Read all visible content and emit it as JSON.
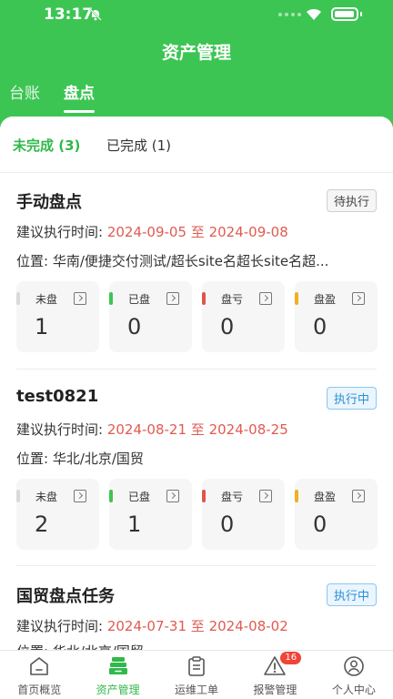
{
  "status_bar": {
    "time": "13:17"
  },
  "header": {
    "title": "资产管理"
  },
  "top_tabs": [
    {
      "label": "台账"
    },
    {
      "label": "盘点"
    }
  ],
  "sub_tabs": [
    {
      "label": "未完成 (3)"
    },
    {
      "label": "已完成 (1)"
    }
  ],
  "tasks": [
    {
      "title": "手动盘点",
      "status": "待执行",
      "time_label": "建议执行时间: ",
      "start": "2024-09-05",
      "sep": " 至 ",
      "end": "2024-09-08",
      "location": "位置: 华南/便捷交付测试/超长site名超长site名超...",
      "stats": [
        {
          "label": "未盘",
          "value": "1",
          "color": "#d9d9d9"
        },
        {
          "label": "已盘",
          "value": "0",
          "color": "#3dc554"
        },
        {
          "label": "盘亏",
          "value": "0",
          "color": "#e0554a"
        },
        {
          "label": "盘盈",
          "value": "0",
          "color": "#f2b021"
        }
      ]
    },
    {
      "title": "test0821",
      "status": "执行中",
      "time_label": "建议执行时间: ",
      "start": "2024-08-21",
      "sep": " 至 ",
      "end": "2024-08-25",
      "location": "位置: 华北/北京/国贸",
      "stats": [
        {
          "label": "未盘",
          "value": "2",
          "color": "#d9d9d9"
        },
        {
          "label": "已盘",
          "value": "1",
          "color": "#3dc554"
        },
        {
          "label": "盘亏",
          "value": "0",
          "color": "#e0554a"
        },
        {
          "label": "盘盈",
          "value": "0",
          "color": "#f2b021"
        }
      ]
    },
    {
      "title": "国贸盘点任务",
      "status": "执行中",
      "time_label": "建议执行时间: ",
      "start": "2024-07-31",
      "sep": " 至 ",
      "end": "2024-08-02",
      "location": "位置: 华北/北京/国贸"
    }
  ],
  "bottom_nav": [
    {
      "label": "首页概览"
    },
    {
      "label": "资产管理"
    },
    {
      "label": "运维工单"
    },
    {
      "label": "报警管理",
      "badge": "16"
    },
    {
      "label": "个人中心"
    }
  ]
}
